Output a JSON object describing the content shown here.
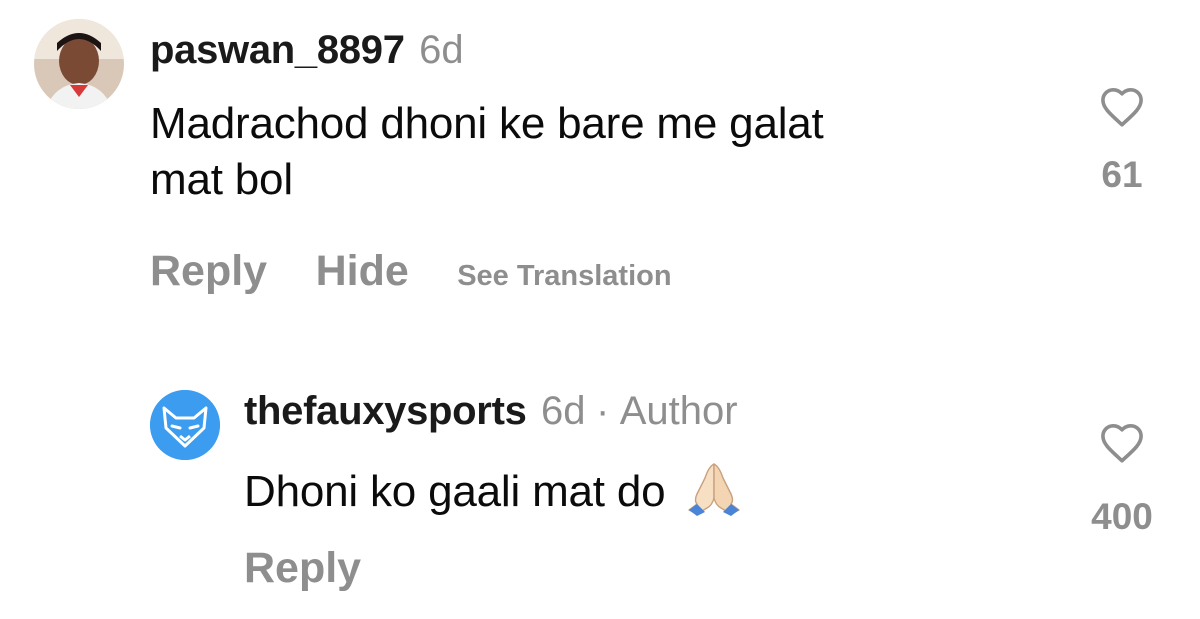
{
  "comments": [
    {
      "username": "paswan_8897",
      "time": "6d",
      "text_lines": [
        "Madrachod dhoni ke bare me galat",
        "mat bol"
      ],
      "actions": {
        "reply": "Reply",
        "hide": "Hide",
        "translate": "See Translation"
      },
      "likes": "61"
    },
    {
      "username": "thefauxysports",
      "time": "6d",
      "separator": "·",
      "badge": "Author",
      "text": "Dhoni ko gaali mat do",
      "emoji_icon": "folded-hands-icon",
      "actions": {
        "reply": "Reply"
      },
      "likes": "400"
    }
  ],
  "colors": {
    "secondary_text": "#8e8e8e",
    "primary_text": "#0b0b0b",
    "brand_avatar_blue": "#3b9cf0"
  }
}
